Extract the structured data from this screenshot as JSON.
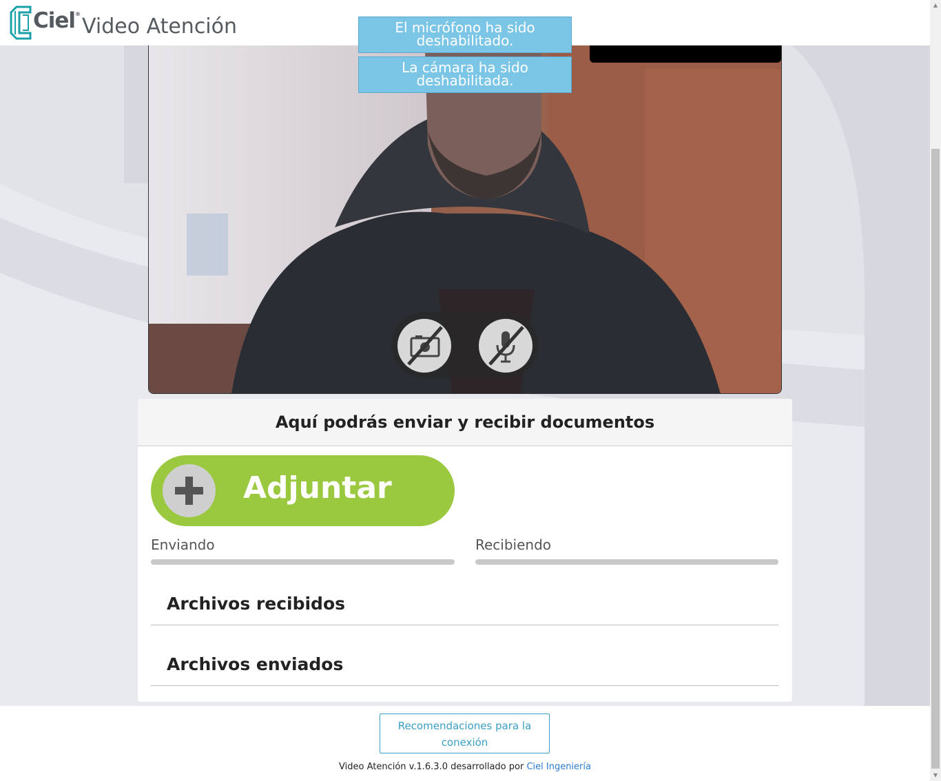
{
  "header": {
    "brand": "Ciel",
    "brand_mark": "®",
    "title": "Video Atención"
  },
  "notifications": [
    {
      "text_line1": "El micrófono ha sido",
      "text_line2": "deshabilitado."
    },
    {
      "text_line1": "La cámara ha sido",
      "text_line2": "deshabilitada."
    }
  ],
  "video_controls": {
    "camera_icon": "camera-off-icon",
    "mic_icon": "microphone-off-icon"
  },
  "documents": {
    "heading": "Aquí podrás enviar y recibir documentos",
    "attach_label": "Adjuntar",
    "attach_icon": "plus-icon",
    "sending_label": "Enviando",
    "receiving_label": "Recibiendo",
    "sending_progress": 0,
    "receiving_progress": 0,
    "received_title": "Archivos recibidos",
    "sent_title": "Archivos enviados"
  },
  "footer": {
    "recommendations_line1": "Recomendaciones para la",
    "recommendations_line2": "conexión",
    "credit": "Video Atención v.1.6.3.0 desarrollado por",
    "credit_link": "Ciel Ingeniería"
  },
  "colors": {
    "accent_green": "#9ac83f",
    "toast_blue": "#7bc5e6",
    "link_blue": "#2a7ccf",
    "brand_teal": "#1aa0a8"
  }
}
